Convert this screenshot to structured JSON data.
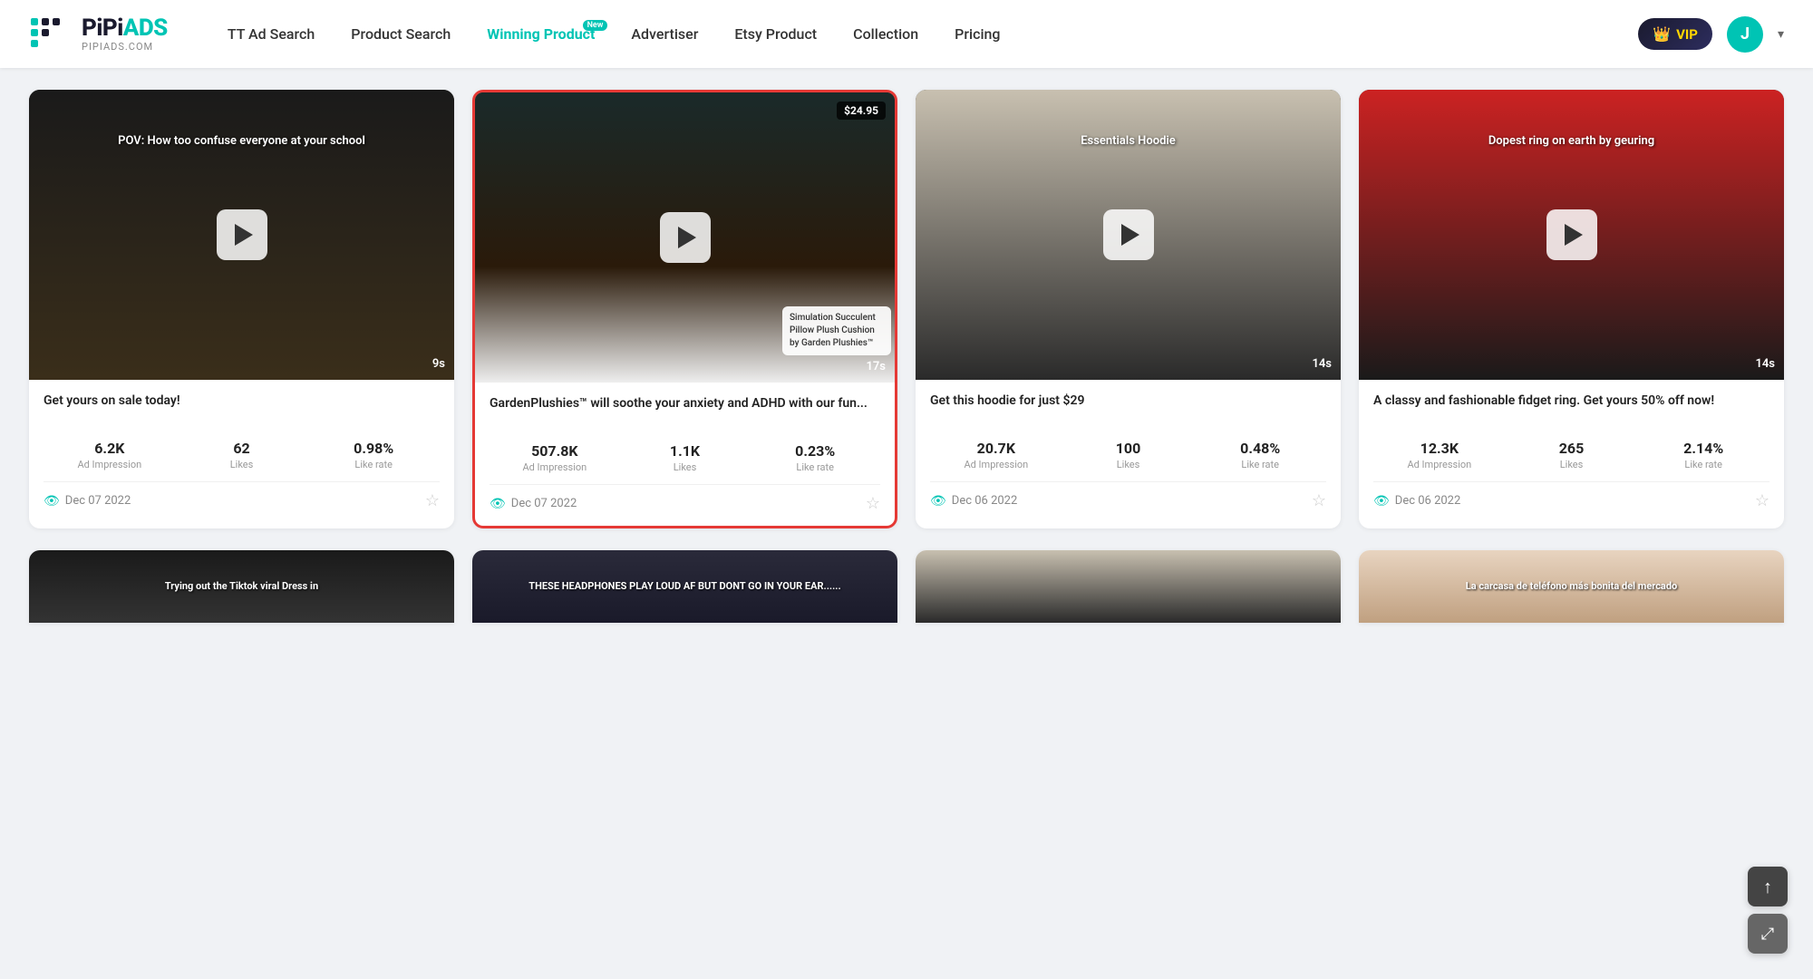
{
  "logo": {
    "main": "PiPiADS",
    "domain": "PIPIADS.COM"
  },
  "nav": {
    "items": [
      {
        "id": "tt-ad-search",
        "label": "TT Ad Search",
        "active": false,
        "badge": null
      },
      {
        "id": "product-search",
        "label": "Product Search",
        "active": false,
        "badge": null
      },
      {
        "id": "winning-product",
        "label": "Winning Product",
        "active": true,
        "badge": "New"
      },
      {
        "id": "advertiser",
        "label": "Advertiser",
        "active": false,
        "badge": null
      },
      {
        "id": "etsy-product",
        "label": "Etsy Product",
        "active": false,
        "badge": null
      },
      {
        "id": "collection",
        "label": "Collection",
        "active": false,
        "badge": null
      },
      {
        "id": "pricing",
        "label": "Pricing",
        "active": false,
        "badge": null
      }
    ],
    "vip_label": "VIP",
    "avatar_letter": "J"
  },
  "cards": [
    {
      "id": "card-1",
      "title": "Get yours on sale today!",
      "duration": "9s",
      "overlay_text": "POV: How too confuse everyone at your school",
      "price_tag": null,
      "product_overlay": null,
      "highlighted": false,
      "stats": {
        "impression": {
          "value": "6.2K",
          "label": "Ad Impression"
        },
        "likes": {
          "value": "62",
          "label": "Likes"
        },
        "like_rate": {
          "value": "0.98%",
          "label": "Like rate"
        }
      },
      "date": "Dec 07 2022",
      "thumb_class": "thumb-dark-hall"
    },
    {
      "id": "card-2",
      "title": "GardenPlushies™ will soothe your anxiety and ADHD with our fun...",
      "duration": "17s",
      "overlay_text": null,
      "price_tag": "$24.95",
      "product_overlay": "Simulation Succulent Pillow Plush Cushion by Garden Plushies™",
      "highlighted": true,
      "stats": {
        "impression": {
          "value": "507.8K",
          "label": "Ad Impression"
        },
        "likes": {
          "value": "1.1K",
          "label": "Likes"
        },
        "like_rate": {
          "value": "0.23%",
          "label": "Like rate"
        }
      },
      "date": "Dec 07 2022",
      "thumb_class": "thumb-teal-plant"
    },
    {
      "id": "card-3",
      "title": "Get this hoodie for just $29",
      "duration": "14s",
      "overlay_text": "Essentials Hoodie",
      "price_tag": null,
      "product_overlay": null,
      "highlighted": false,
      "stats": {
        "impression": {
          "value": "20.7K",
          "label": "Ad Impression"
        },
        "likes": {
          "value": "100",
          "label": "Likes"
        },
        "like_rate": {
          "value": "0.48%",
          "label": "Like rate"
        }
      },
      "date": "Dec 06 2022",
      "thumb_class": "thumb-hoodie"
    },
    {
      "id": "card-4",
      "title": "A classy and fashionable fidget ring. Get yours 50% off now!",
      "duration": "14s",
      "overlay_text": "Dopest ring on earth by geuring",
      "price_tag": null,
      "product_overlay": null,
      "highlighted": false,
      "stats": {
        "impression": {
          "value": "12.3K",
          "label": "Ad Impression"
        },
        "likes": {
          "value": "265",
          "label": "Likes"
        },
        "like_rate": {
          "value": "2.14%",
          "label": "Like rate"
        }
      },
      "date": "Dec 06 2022",
      "thumb_class": "thumb-ring"
    }
  ],
  "partial_cards": [
    {
      "id": "p1",
      "text": "Trying out the Tiktok viral Dress in",
      "thumb_class": "thumb-dress"
    },
    {
      "id": "p2",
      "text": "THESE HEADPHONES PLAY LOUD AF BUT DONT GO IN YOUR EAR......",
      "thumb_class": "thumb-headphones"
    },
    {
      "id": "p3",
      "text": "",
      "thumb_class": "thumb-hoodie"
    },
    {
      "id": "p4",
      "text": "La carcasa de teléfono más bonita del mercado",
      "thumb_class": "thumb-phone"
    }
  ],
  "scroll_top_label": "↑",
  "expand_label": "⤢"
}
